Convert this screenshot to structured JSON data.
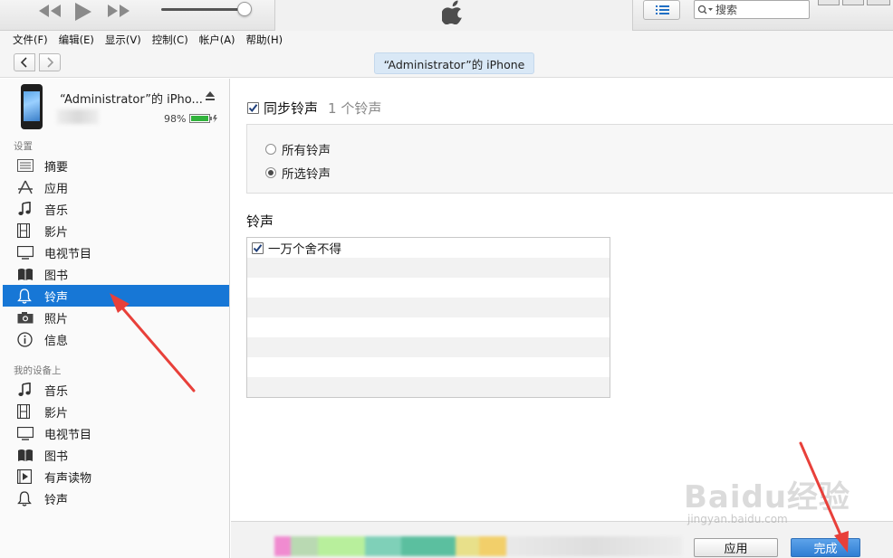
{
  "menu": [
    "文件(F)",
    "编辑(E)",
    "显示(V)",
    "控制(C)",
    "帐户(A)",
    "帮助(H)"
  ],
  "search": {
    "placeholder": "搜索"
  },
  "nav": {
    "device_title": "“Administrator”的 iPhone"
  },
  "device": {
    "name": "“Administrator”的 iPho...",
    "battery": "98%"
  },
  "sidebar": {
    "settings_label": "设置",
    "settings_items": [
      "摘要",
      "应用",
      "音乐",
      "影片",
      "电视节目",
      "图书",
      "铃声",
      "照片",
      "信息"
    ],
    "on_device_label": "我的设备上",
    "device_items": [
      "音乐",
      "影片",
      "电视节目",
      "图书",
      "有声读物",
      "铃声"
    ],
    "selected": "铃声"
  },
  "main": {
    "sync_label": "同步铃声",
    "sync_count": "1 个铃声",
    "option_all": "所有铃声",
    "option_selected": "所选铃声",
    "ringtones_heading": "铃声",
    "ringtones": [
      "一万个舍不得"
    ]
  },
  "buttons": {
    "apply": "应用",
    "done": "完成"
  },
  "watermark": {
    "logo": "Baidu经验",
    "url": "jingyan.baidu.com"
  },
  "colors": {
    "selection": "#1777d6",
    "done_button": "#2f7ed3",
    "annotation_arrow": "#e8403a"
  }
}
